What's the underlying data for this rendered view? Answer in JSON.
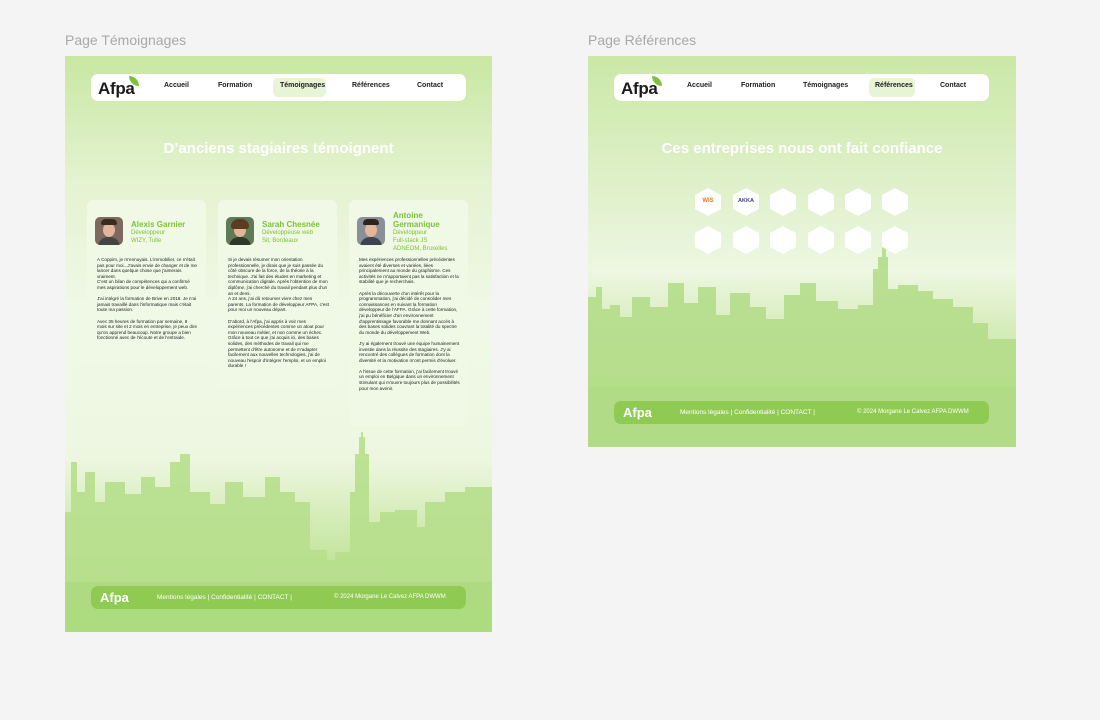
{
  "frames": {
    "temoignages_label": "Page Témoignages",
    "references_label": "Page Références"
  },
  "nav": {
    "logo": "Afpa",
    "items": [
      "Accueil",
      "Formation",
      "Témoignages",
      "Références",
      "Contact"
    ]
  },
  "temoignages": {
    "title": "D’anciens stagiaires témoignent",
    "cards": [
      {
        "name": "Alexis Garnier",
        "role": "Développeur",
        "company": "WIZY, Tulle",
        "text": "A Coppim, je m'ennuyais. L'immobilier, ce n'était pas pour moi...J'avais envie de changer et de me lancer dans quelque chose que j'aimerais vraiment.\nC'est un bilan de compétences qui a confirmé mes aspirations pour le développement web.\n\nJ'ai intégré la formation de Brive en 2018. Je n'ai jamais travaillé dans l'informatique mais c'était toute ma passion.\n\nAvec 35 heures de formation par semaine, 8 mois sur site et 2 mois en entreprise, je peux dire qu'on apprend beaucoup. Notre groupe a bien fonctionné avec de l'écoute et de l'entraide."
      },
      {
        "name": "Sarah Chesnée",
        "role": "Développeuse web",
        "company": "Sit, Bordeaux",
        "text": "Si je devais résumer mon orientation professionnelle, je dirais que je suis passée du côté obscure de la force, de la théorie à la technique. J'ai fait des études en marketing et communication digitale. Après l'obtention de mon diplôme, j'ai cherché du travail pendant plus d'un an et demi.\nA 24 ans, j'ai dû retourner vivre chez mes parents. La formation de développeur AFPA, c'est pour moi un nouveau départ.\n\nD'abord, à l'Afpa, j'ai appris à voir mes expériences précédentes comme un atout pour mon nouveau métier, et non comme un échec. Grâce à tout ce que j'ai acquis ici, des bases solides, des méthodes de travail qui me permettent d'être autonome et de m'adapter facilement aux nouvelles technologies, j'ai de nouveau l'espoir d'intégrer l'emploi, et un emploi durable !"
      },
      {
        "name": "Antoine Germanique",
        "role": "Développeur",
        "role2": "Full-stack JS",
        "company": "ADNEOM, Bruxelles",
        "text": "Mes expériences professionnelles précédentes avaient été diverses et variées, liées principalement au monde du graphisme. Ces activités ne m'apportaient pas la satisfaction et la stabilité que je recherchais.\n\nAprès la découverte d'un intérêt pour la programmation, j'ai décidé de consolider mes connaissances en suivant la formation développeur de l'AFPA. Grâce à cette formation, j'ai pu bénéficier d'un environnement d'apprentissage favorable me donnant accès à des bases solides couvrant la totalité du spectre du monde du développement Web.\n\nJ'y ai également trouvé une équipe humainement investie dans la réussite des stagiaires. J'y ai rencontré des collègues de formation dont la diversité et la motivation m'ont permis d'évoluer.\n\nA l'issue de cette formation, j'ai facilement trouvé un emploi en Belgique dans un environnement stimulant qui m'ouvre toujours plus de possibilités pour mon avenir."
      }
    ]
  },
  "references": {
    "title": "Ces entreprises nous ont fait confiance",
    "logos": [
      "WIS",
      "AKKA"
    ]
  },
  "footer": {
    "logo": "Afpa",
    "links": "Mentions légales | Confidentialité | CONTACT |",
    "copyright": "© 2024 Morgane Le Calvez AFPA DWWM"
  },
  "colors": {
    "accent": "#7cc23a",
    "footer": "#8fcb53"
  }
}
